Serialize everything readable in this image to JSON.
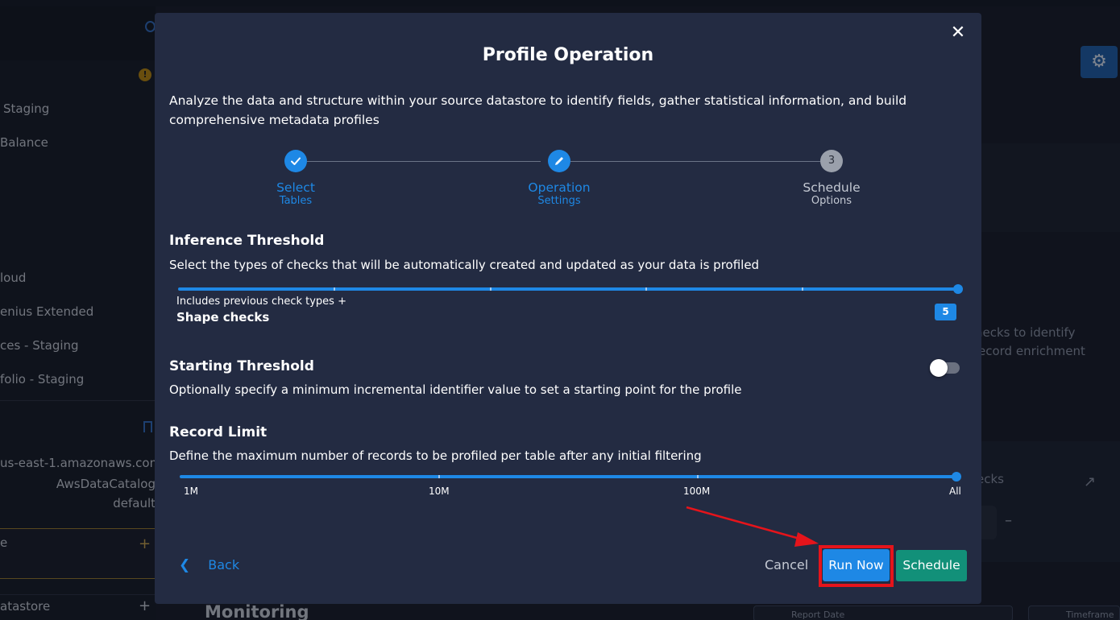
{
  "background": {
    "sidebar_items": [
      "Staging",
      "Balance",
      "loud",
      "enius Extended",
      "ces - Staging",
      "folio - Staging"
    ],
    "sidebar_details": [
      "us-east-1.amazonaws.com",
      "AwsDataCatalog",
      "default"
    ],
    "add_item_label": "e",
    "datastore_label": "atastore",
    "right_text_line1": "hecks to identify",
    "right_text_line2": "ecord enrichment",
    "checks_label": "ecks",
    "checks_value": "–",
    "monitoring_title": "Monitoring",
    "report_date_chip": "Report Date",
    "timeframe_chip": "Timeframe"
  },
  "modal": {
    "title": "Profile Operation",
    "close_label": "✕",
    "description": "Analyze the data and structure within your source datastore to identify fields, gather statistical information, and build comprehensive metadata profiles",
    "steps": [
      {
        "main": "Select",
        "sub": "Tables",
        "state": "done",
        "icon": "check-icon"
      },
      {
        "main": "Operation",
        "sub": "Settings",
        "state": "active",
        "icon": "pencil-icon"
      },
      {
        "main": "Schedule",
        "sub": "Options",
        "state": "todo",
        "number": "3"
      }
    ],
    "inference": {
      "title": "Inference Threshold",
      "description": "Select the types of checks that will be automatically created and updated as your data is profiled",
      "caption": "Includes previous check types +",
      "current": "Shape checks",
      "value": "5",
      "max": 5
    },
    "starting": {
      "title": "Starting Threshold",
      "description": "Optionally specify a minimum incremental identifier value to set a starting point for the profile",
      "enabled": false
    },
    "record_limit": {
      "title": "Record Limit",
      "description": "Define the maximum number of records to be profiled per table after any initial filtering",
      "labels": [
        "1M",
        "10M",
        "100M",
        "All"
      ],
      "selected": "All"
    },
    "buttons": {
      "back": "Back",
      "cancel": "Cancel",
      "run_now": "Run Now",
      "schedule": "Schedule"
    }
  },
  "colors": {
    "accent": "#1e88e5",
    "schedule": "#129079",
    "highlight": "#e5141b",
    "modal_bg": "#232b42"
  }
}
